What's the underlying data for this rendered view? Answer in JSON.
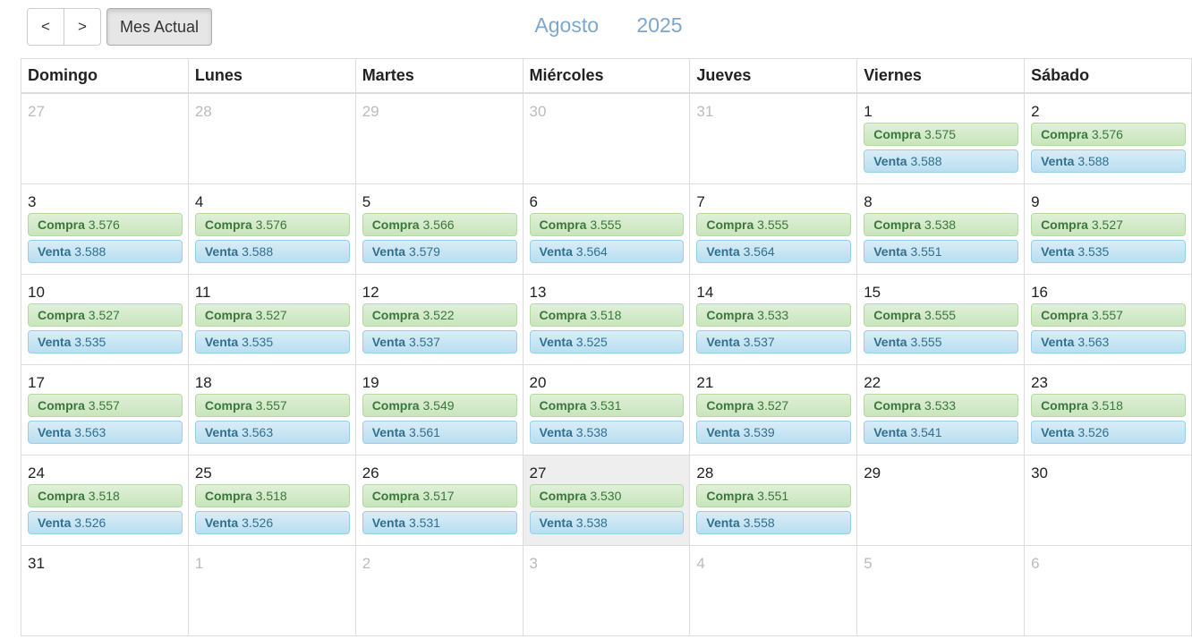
{
  "toolbar": {
    "prev_label": "<",
    "next_label": ">",
    "today_label": "Mes Actual"
  },
  "title": {
    "month": "Agosto",
    "year": "2025"
  },
  "weekdays": [
    "Domingo",
    "Lunes",
    "Martes",
    "Miércoles",
    "Jueves",
    "Viernes",
    "Sábado"
  ],
  "labels": {
    "buy": "Compra",
    "sell": "Venta"
  },
  "weeks": [
    [
      {
        "day": "27",
        "other": true
      },
      {
        "day": "28",
        "other": true
      },
      {
        "day": "29",
        "other": true
      },
      {
        "day": "30",
        "other": true
      },
      {
        "day": "31",
        "other": true
      },
      {
        "day": "1",
        "buy": "3.575",
        "sell": "3.588"
      },
      {
        "day": "2",
        "buy": "3.576",
        "sell": "3.588"
      }
    ],
    [
      {
        "day": "3",
        "buy": "3.576",
        "sell": "3.588"
      },
      {
        "day": "4",
        "buy": "3.576",
        "sell": "3.588"
      },
      {
        "day": "5",
        "buy": "3.566",
        "sell": "3.579"
      },
      {
        "day": "6",
        "buy": "3.555",
        "sell": "3.564"
      },
      {
        "day": "7",
        "buy": "3.555",
        "sell": "3.564"
      },
      {
        "day": "8",
        "buy": "3.538",
        "sell": "3.551"
      },
      {
        "day": "9",
        "buy": "3.527",
        "sell": "3.535"
      }
    ],
    [
      {
        "day": "10",
        "buy": "3.527",
        "sell": "3.535"
      },
      {
        "day": "11",
        "buy": "3.527",
        "sell": "3.535"
      },
      {
        "day": "12",
        "buy": "3.522",
        "sell": "3.537"
      },
      {
        "day": "13",
        "buy": "3.518",
        "sell": "3.525"
      },
      {
        "day": "14",
        "buy": "3.533",
        "sell": "3.537"
      },
      {
        "day": "15",
        "buy": "3.555",
        "sell": "3.555"
      },
      {
        "day": "16",
        "buy": "3.557",
        "sell": "3.563"
      }
    ],
    [
      {
        "day": "17",
        "buy": "3.557",
        "sell": "3.563"
      },
      {
        "day": "18",
        "buy": "3.557",
        "sell": "3.563"
      },
      {
        "day": "19",
        "buy": "3.549",
        "sell": "3.561"
      },
      {
        "day": "20",
        "buy": "3.531",
        "sell": "3.538"
      },
      {
        "day": "21",
        "buy": "3.527",
        "sell": "3.539"
      },
      {
        "day": "22",
        "buy": "3.533",
        "sell": "3.541"
      },
      {
        "day": "23",
        "buy": "3.518",
        "sell": "3.526"
      }
    ],
    [
      {
        "day": "24",
        "buy": "3.518",
        "sell": "3.526"
      },
      {
        "day": "25",
        "buy": "3.518",
        "sell": "3.526"
      },
      {
        "day": "26",
        "buy": "3.517",
        "sell": "3.531"
      },
      {
        "day": "27",
        "buy": "3.530",
        "sell": "3.538",
        "today": true
      },
      {
        "day": "28",
        "buy": "3.551",
        "sell": "3.558"
      },
      {
        "day": "29"
      },
      {
        "day": "30"
      }
    ],
    [
      {
        "day": "31"
      },
      {
        "day": "1",
        "other": true
      },
      {
        "day": "2",
        "other": true
      },
      {
        "day": "3",
        "other": true
      },
      {
        "day": "4",
        "other": true
      },
      {
        "day": "5",
        "other": true
      },
      {
        "day": "6",
        "other": true
      }
    ]
  ],
  "colors": {
    "title": "#7ba7cf",
    "buy_bg": "#dff0d8",
    "buy_text": "#3c763d",
    "sell_bg": "#d9edf7",
    "sell_text": "#31708f",
    "today_bg": "#eeeeee"
  }
}
